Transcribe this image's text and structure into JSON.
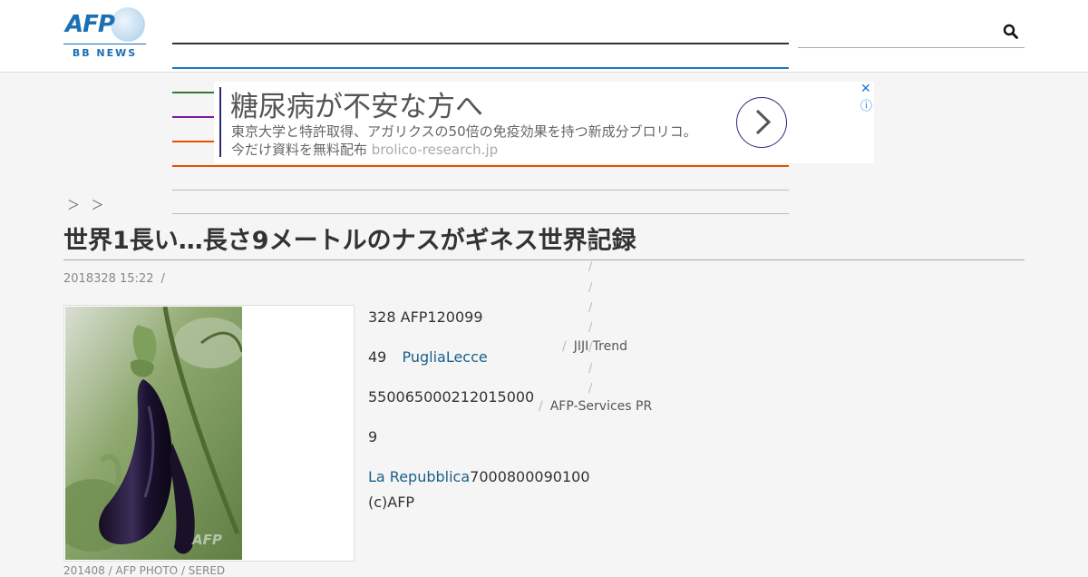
{
  "header": {
    "logo_text": "AFP",
    "logo_sub": "BB NEWS",
    "nav_colors": [
      "#333333",
      "#1a78c2",
      "#2e7d32",
      "#7b1fa2",
      "#e65100",
      "#e65100",
      "#bbbbbb",
      "#bbbbbb"
    ],
    "search_placeholder": ""
  },
  "ad": {
    "headline": "糖尿病が不安な方へ",
    "line1": "東京大学と特許取得、アガリクスの50倍の免疫効果を持つ新成分ブロリコ。",
    "line2": "今だけ資料を無料配布",
    "domain": "brolico-research.jp",
    "close": "✕",
    "info": "ⓘ"
  },
  "article": {
    "breadcrumb": "＞ ＞",
    "title": "世界1長い…長さ9メートルのナスがギネス世界記録",
    "date": "2018328 15:22",
    "meta_sep": "/",
    "photo_caption": "201408 / AFP PHOTO / SERED",
    "paragraphs": [
      {
        "text": "328 AFP120099"
      },
      {
        "prefix": "49",
        "link": "PugliaLecce"
      },
      {
        "text": "550065000212015000"
      },
      {
        "text": "9"
      },
      {
        "link": "La Repubblica",
        "suffix": "7000800090100"
      },
      {
        "text": "(c)AFP"
      }
    ]
  },
  "sidebar": {
    "slashes": [
      "/",
      "/",
      "/",
      "/",
      "/",
      "/",
      "/",
      "/"
    ],
    "items": [
      {
        "sep": "/",
        "label": "JIJI Trend"
      },
      {
        "sep": "/",
        "label": "AFP-Services PR"
      }
    ]
  }
}
